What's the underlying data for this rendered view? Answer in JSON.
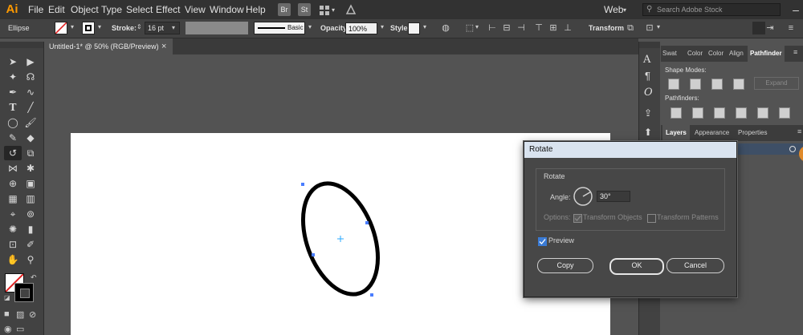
{
  "app": {
    "logo": "Ai",
    "menu": [
      "File",
      "Edit",
      "Object",
      "Type",
      "Select",
      "Effect",
      "View",
      "Window",
      "Help"
    ],
    "bridge_label": "Br",
    "stock_label": "St",
    "workspace": "Web",
    "search_placeholder": "Search Adobe Stock"
  },
  "control_bar": {
    "object_type": "Ellipse",
    "stroke_label": "Stroke:",
    "stroke_value": "16 pt",
    "brush_label": "Basic",
    "opacity_label": "Opacity:",
    "opacity_value": "100%",
    "style_label": "Style:",
    "transform_label": "Transform"
  },
  "document": {
    "tab_title": "Untitled-1* @ 50% (RGB/Preview)",
    "close_glyph": "×"
  },
  "panels": {
    "top_tabs": [
      "Swat",
      "Color",
      "Color",
      "Align",
      "Pathfinder"
    ],
    "active_top_tab": "Pathfinder",
    "shape_modes_label": "Shape Modes:",
    "expand_label": "Expand",
    "pathfinders_label": "Pathfinders:",
    "bottom_tabs": [
      "Layers",
      "Appearance",
      "Properties"
    ],
    "active_bottom_tab": "Layers"
  },
  "dialog": {
    "title": "Rotate",
    "section_label": "Rotate",
    "angle_label": "Angle:",
    "angle_value": "30°",
    "options_label": "Options:",
    "transform_objects_label": "Transform Objects",
    "transform_patterns_label": "Transform Patterns",
    "preview_label": "Preview",
    "preview_checked": true,
    "copy_label": "Copy",
    "ok_label": "OK",
    "cancel_label": "Cancel"
  },
  "colors": {
    "ui_dark": "#323232",
    "ui_panel": "#424242",
    "canvas": "#535353",
    "accent_orange": "#ff9a00",
    "selection_blue": "#4a7dff"
  }
}
